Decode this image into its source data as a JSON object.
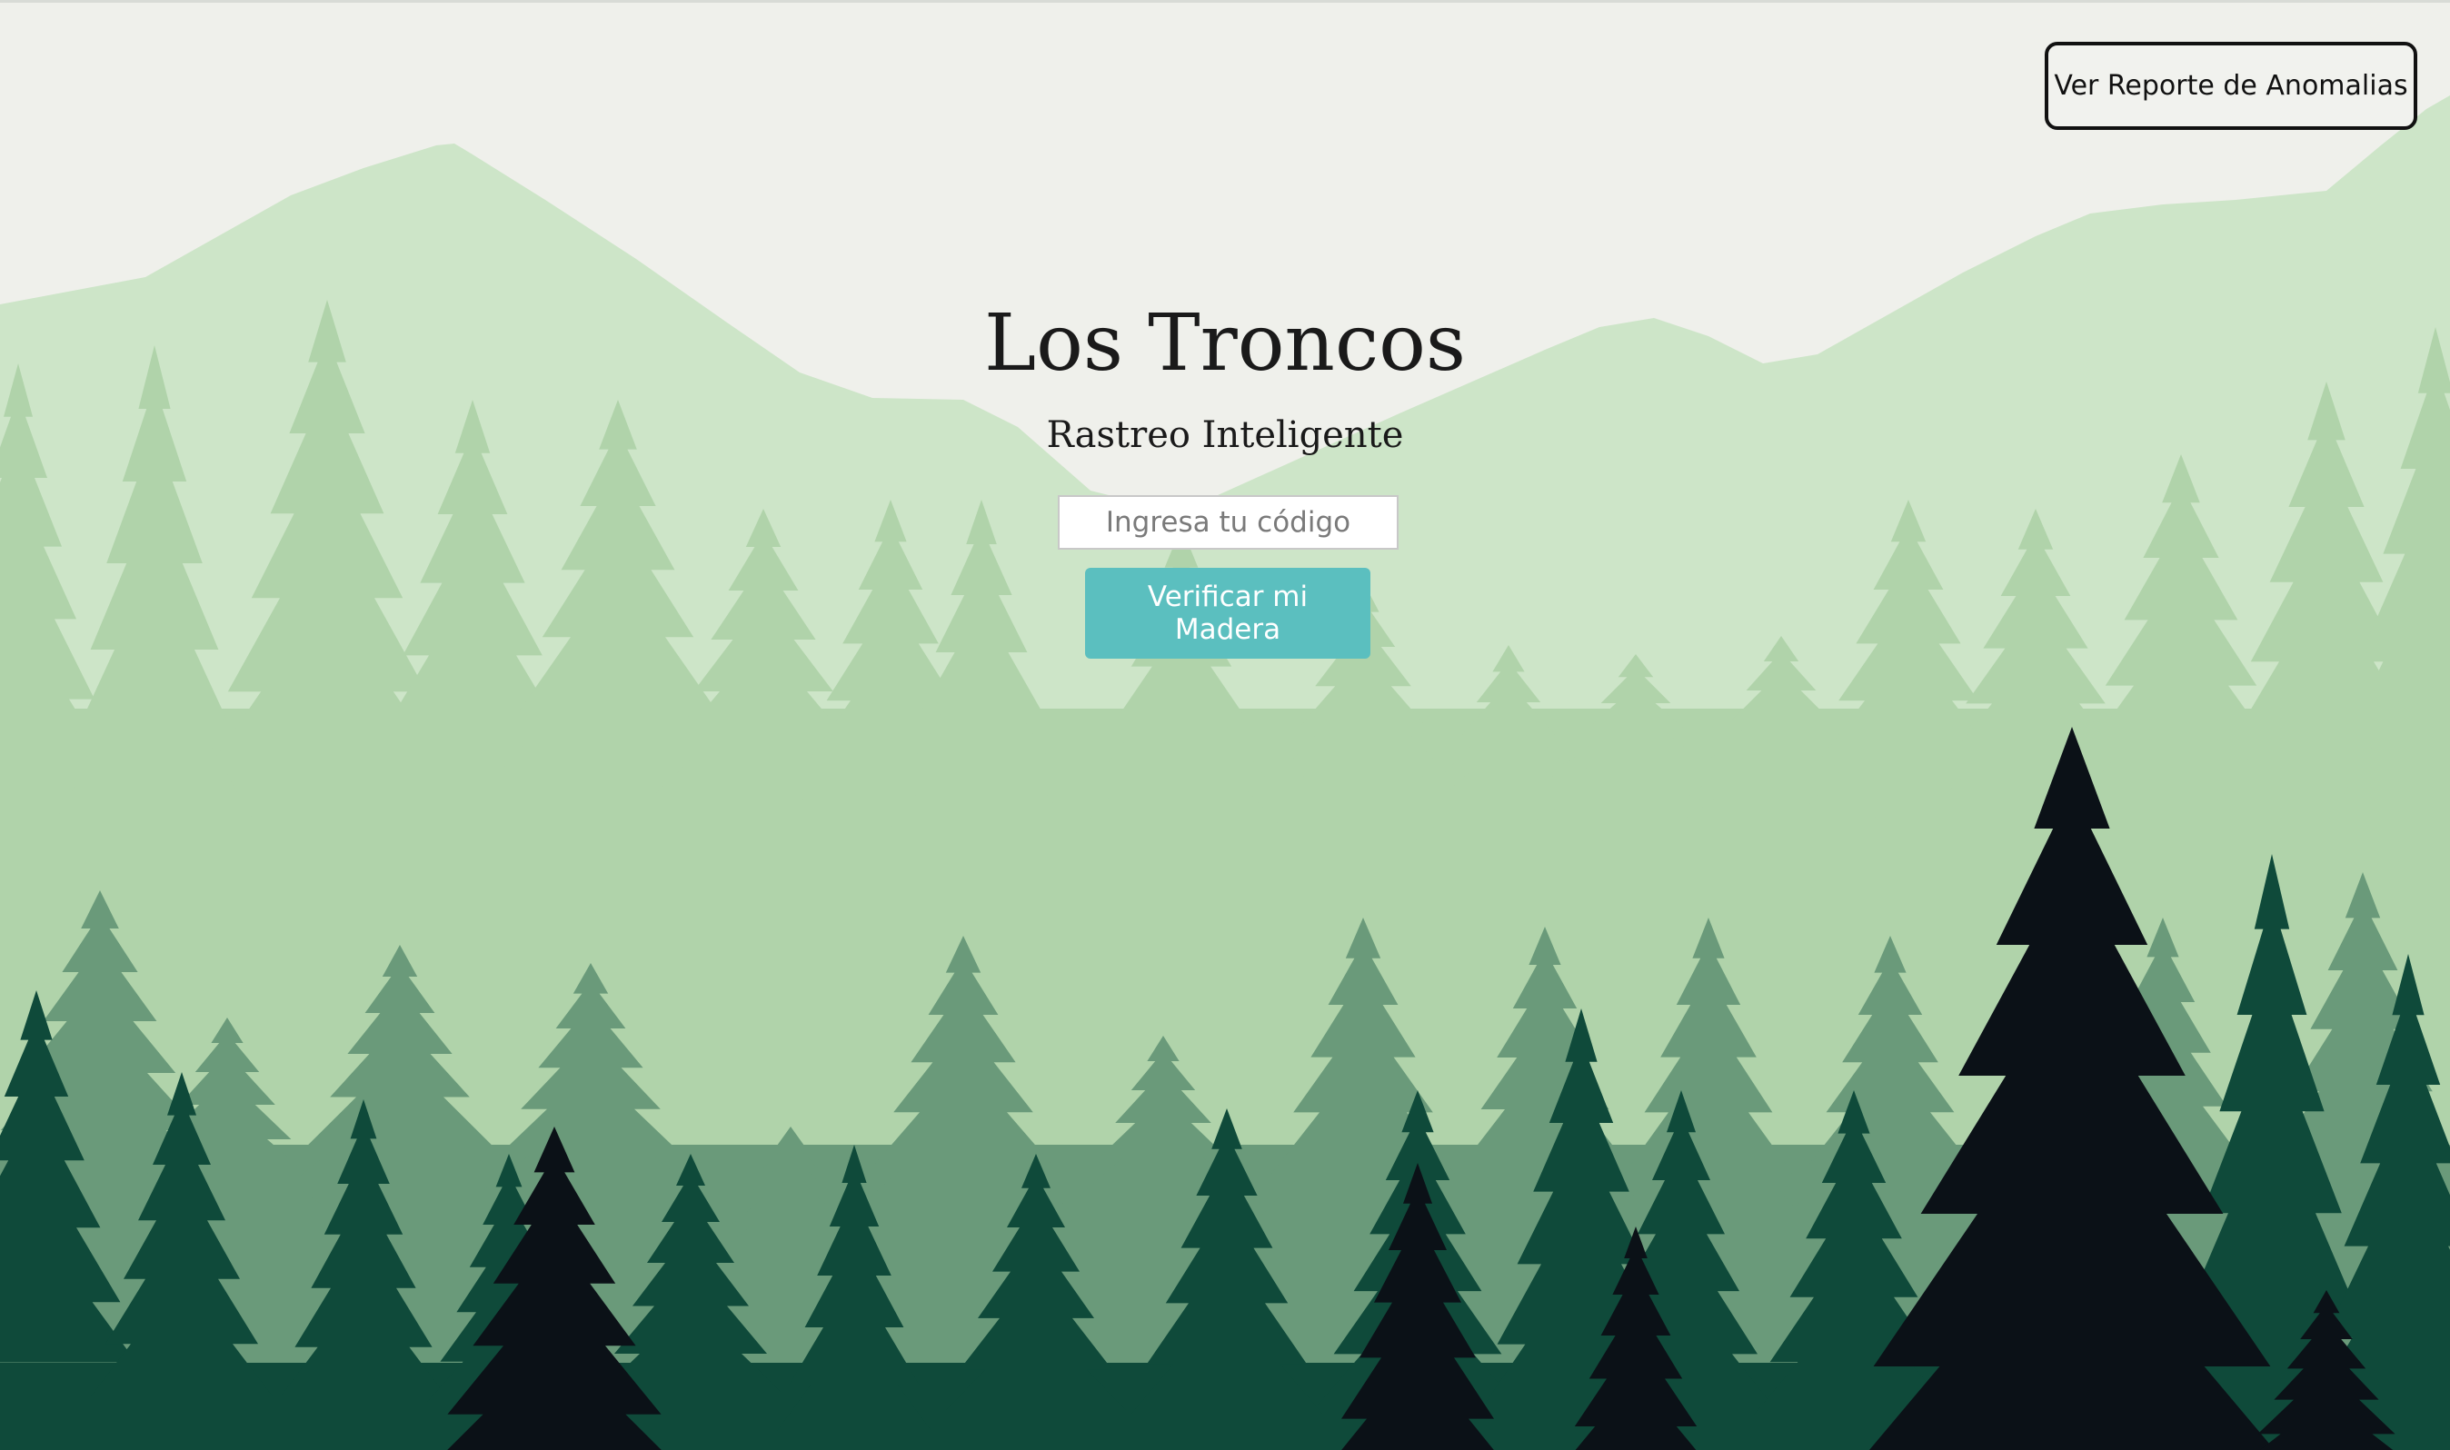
{
  "header": {
    "report_button_label": "Ver Reporte de Anomalias"
  },
  "hero": {
    "title": "Los Troncos",
    "subtitle": "Rastreo Inteligente",
    "code_input": {
      "value": "",
      "placeholder": "Ingresa tu código"
    },
    "verify_button_label": "Verificar mi Madera"
  },
  "background": {
    "description_icon": "forest-mountain-illustration",
    "colors": {
      "sky": "#eff0eb",
      "far_mountain": "#cde5c8",
      "trees_light": "#b0d3aa",
      "trees_mid": "#6a9a7a",
      "trees_dark": "#0f4a3a",
      "trees_darkest": "#0b1117"
    }
  },
  "theme": {
    "accent": "#5bbfbf"
  }
}
